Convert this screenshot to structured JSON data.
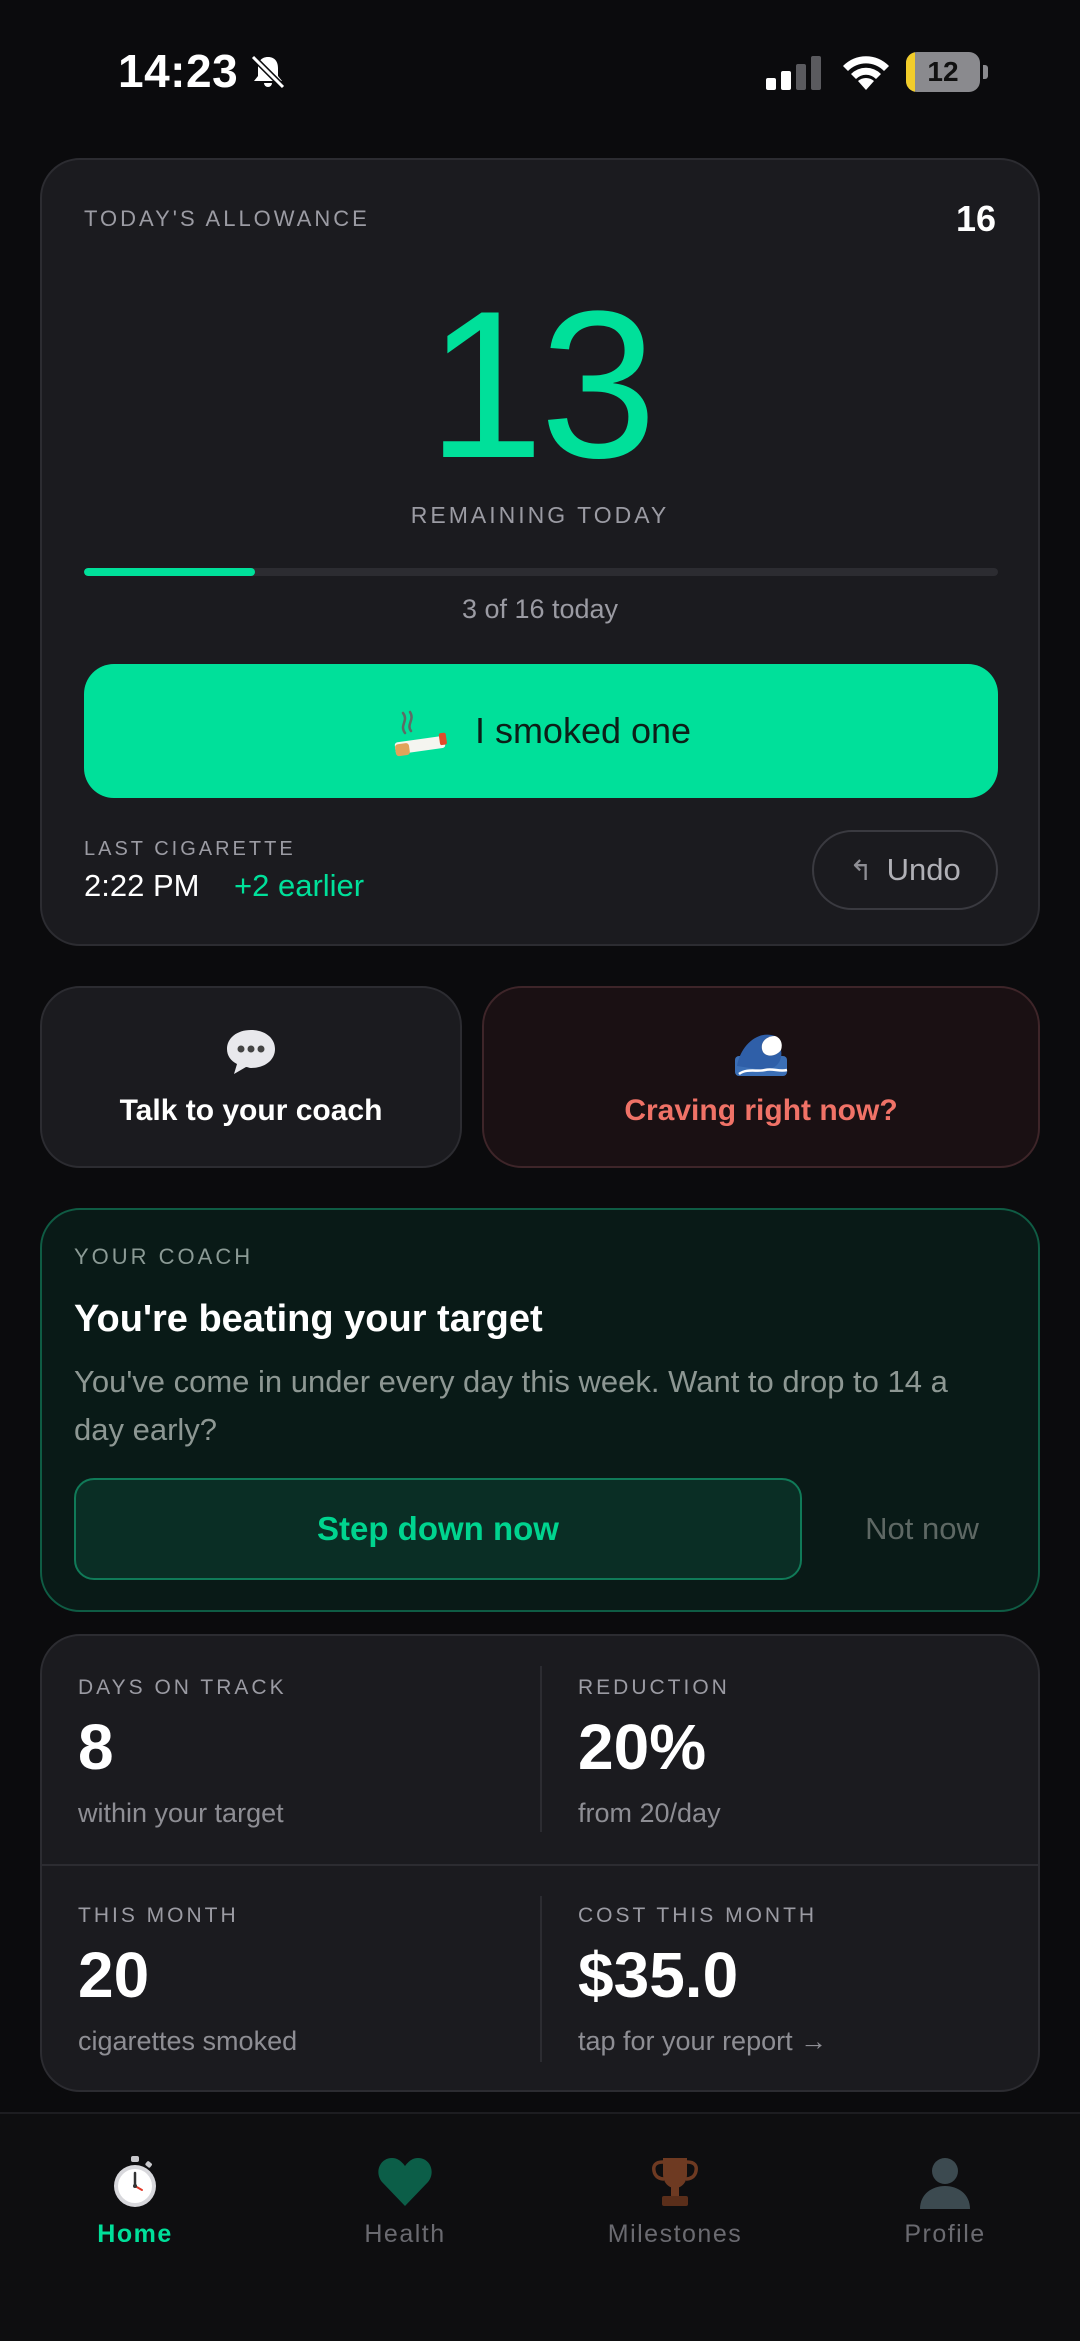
{
  "status_bar": {
    "time": "14:23",
    "battery": "12",
    "battery_level": 0.12,
    "icons": [
      "bell-muted-icon",
      "signal-icon",
      "wifi-icon",
      "battery-icon"
    ]
  },
  "allowance": {
    "label": "TODAY'S ALLOWANCE",
    "total": "16",
    "remaining": "13",
    "remaining_label": "REMAINING TODAY",
    "progress_fraction": 0.1875,
    "progress_text": "3 of 16 today",
    "smoke_button_label": "I smoked one",
    "smoke_icon": "cigarette-icon",
    "last_label": "LAST CIGARETTE",
    "last_time": "2:22 PM",
    "last_earlier": "+2 earlier",
    "undo_icon": "undo-arrow-icon",
    "undo_label": "Undo"
  },
  "actions": {
    "coach_label": "Talk to your coach",
    "coach_icon": "speech-bubble-icon",
    "craving_label": "Craving right now?",
    "craving_icon": "wave-icon"
  },
  "coach_card": {
    "tag": "YOUR COACH",
    "title": "You're beating your target",
    "body": "You've come in under every day this week. Want to drop to 14 a day early?",
    "step_label": "Step down now",
    "notnow_label": "Not now"
  },
  "stats": {
    "days_label": "DAYS ON TRACK",
    "days_value": "8",
    "days_sub": "within your target",
    "reduction_label": "REDUCTION",
    "reduction_value": "20%",
    "reduction_sub": "from 20/day",
    "month_label": "THIS MONTH",
    "month_value": "20",
    "month_sub": "cigarettes smoked",
    "cost_label": "COST THIS MONTH",
    "cost_value": "$35.0",
    "cost_sub": "tap for your report →"
  },
  "tabs": [
    {
      "label": "Home",
      "icon": "stopwatch-icon",
      "active": true
    },
    {
      "label": "Health",
      "icon": "heart-icon",
      "active": false
    },
    {
      "label": "Milestones",
      "icon": "trophy-icon",
      "active": false
    },
    {
      "label": "Profile",
      "icon": "profile-icon",
      "active": false
    }
  ],
  "colors": {
    "accent": "#00e09a",
    "background": "#0b0b0d",
    "card": "#1b1b1f",
    "craving": "#f07267",
    "coach_card": "#091a17"
  }
}
